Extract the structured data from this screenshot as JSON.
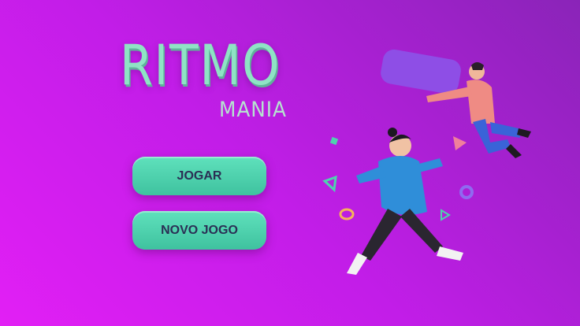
{
  "game": {
    "title": "RITMO",
    "subtitle": "MANIA"
  },
  "menu": {
    "play_label": "JOGAR",
    "new_game_label": "NOVO JOGO"
  },
  "colors": {
    "accent": "#4fd2ae",
    "title": "#8fe3c5",
    "background": "#c21de8"
  }
}
